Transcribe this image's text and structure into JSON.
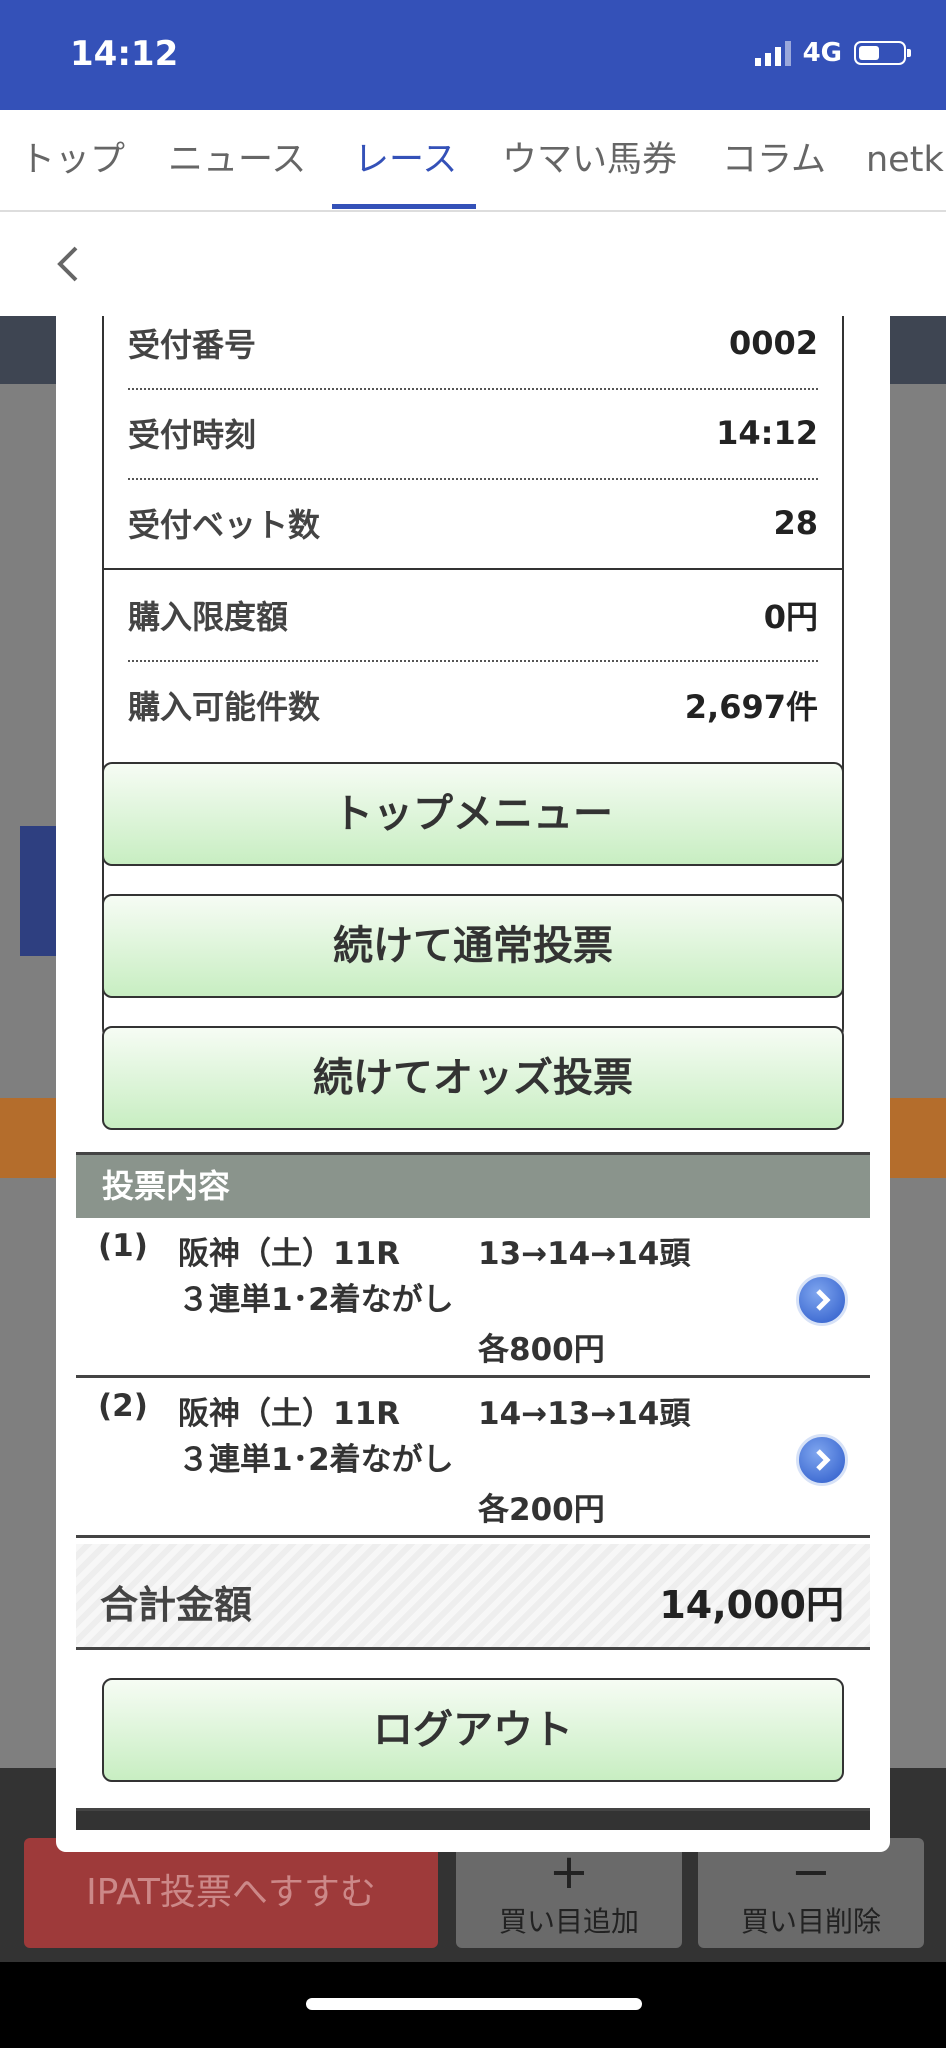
{
  "status_bar": {
    "time": "14:12",
    "network": "4G"
  },
  "tabs": [
    {
      "label": "トップ"
    },
    {
      "label": "ニュース"
    },
    {
      "label": "レース",
      "active": true
    },
    {
      "label": "ウマい馬券"
    },
    {
      "label": "コラム"
    },
    {
      "label": "netk"
    }
  ],
  "background": {
    "ipat_label": "IPAT投票へすすむ",
    "add_label": "買い目追加",
    "add_symbol": "+",
    "remove_label": "買い目削除",
    "remove_symbol": "−"
  },
  "receipt": {
    "rows": [
      {
        "label": "受付番号",
        "value": "0002"
      },
      {
        "label": "受付時刻",
        "value": "14:12"
      },
      {
        "label": "受付ベット数",
        "value": "28"
      },
      {
        "label": "購入限度額",
        "value": "0円"
      },
      {
        "label": "購入可能件数",
        "value": "2,697件"
      }
    ]
  },
  "buttons": {
    "top_menu": "トップメニュー",
    "continue_normal": "続けて通常投票",
    "continue_odds": "続けてオッズ投票",
    "logout": "ログアウト"
  },
  "vote_section": {
    "header": "投票内容",
    "items": [
      {
        "no": "(1)",
        "venue": "阪神（土）11R",
        "type": "３連単1･2着ながし",
        "combo": "13→14→14頭",
        "amount": "各800円"
      },
      {
        "no": "(2)",
        "venue": "阪神（土）11R",
        "type": "３連単1･2着ながし",
        "combo": "14→13→14頭",
        "amount": "各200円"
      }
    ],
    "total_label": "合計金額",
    "total_value": "14,000円"
  },
  "colors": {
    "accent": "#3451b8",
    "button_green": "#c8eec2",
    "section_header": "#8a948c"
  }
}
